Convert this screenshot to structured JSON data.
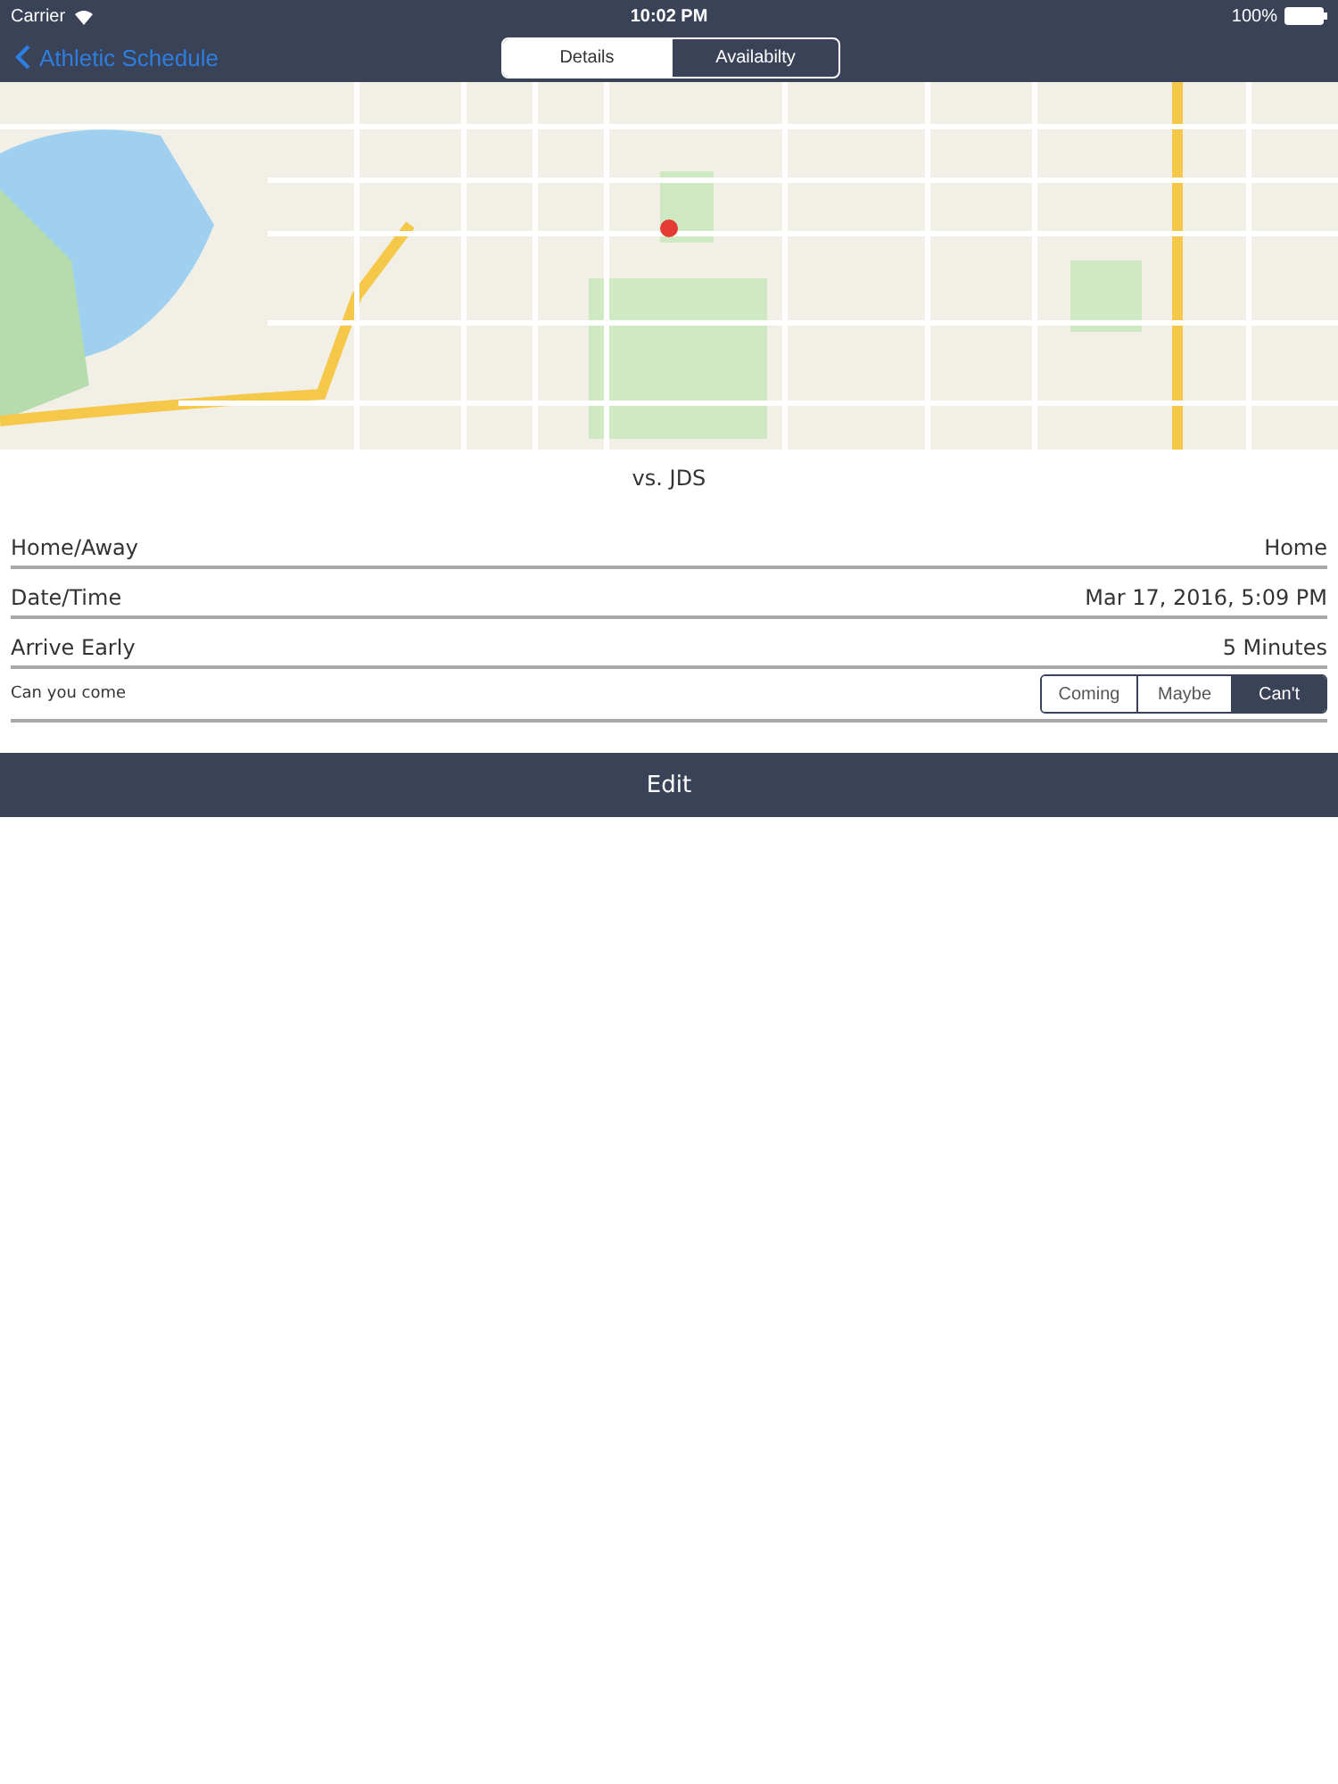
{
  "status_bar": {
    "carrier": "Carrier",
    "time": "10:02 PM",
    "battery": "100%"
  },
  "nav": {
    "back": "Athletic Schedule",
    "tabs": [
      {
        "label": "Details",
        "selected": true
      },
      {
        "label": "Availabilty",
        "selected": false
      }
    ]
  },
  "title": "vs. JDS",
  "rows": [
    {
      "kind": "text",
      "label": "Home/Away",
      "value": "Home"
    },
    {
      "kind": "text",
      "label": "Date/Time",
      "value": "Mar 17, 2016, 5:09 PM"
    },
    {
      "kind": "text",
      "label": "Arrive Early",
      "value": "5 Minutes"
    },
    {
      "kind": "choice",
      "label": "Can you come",
      "options": [
        {
          "label": "Coming",
          "selected": false
        },
        {
          "label": "Maybe",
          "selected": false
        },
        {
          "label": "Can't",
          "selected": true
        }
      ]
    }
  ],
  "edit_button": "Edit"
}
